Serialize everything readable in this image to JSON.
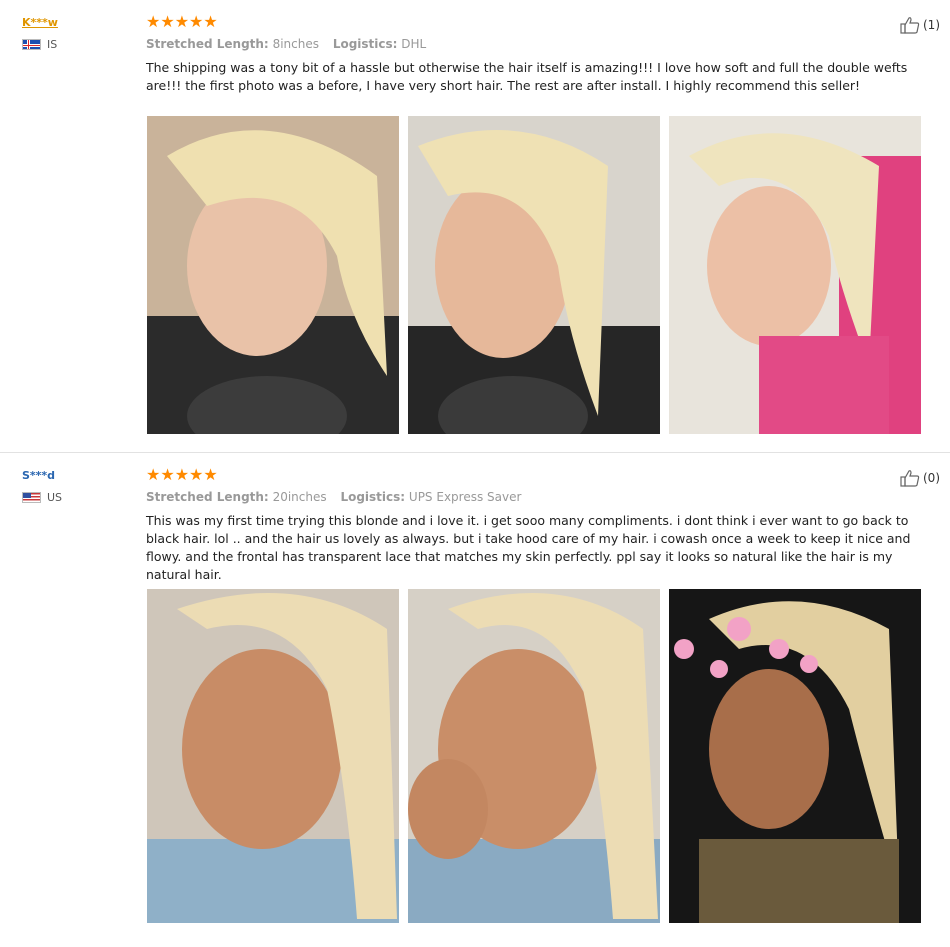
{
  "reviews": [
    {
      "user": "K***w",
      "country_code": "IS",
      "rating": "★★★★★",
      "length_label": "Stretched Length:",
      "length_value": "8inches",
      "logistics_label": "Logistics:",
      "logistics_value": "DHL",
      "helpful_count": "(1)",
      "text": "The shipping was a tony bit of a hassle but otherwise the hair itself is amazing!!! I love how soft and full the double wefts are!!! the first photo was a before, I have very short hair. The rest are after install. I highly recommend this seller!"
    },
    {
      "user": "S***d",
      "country_code": "US",
      "rating": "★★★★★",
      "length_label": "Stretched Length:",
      "length_value": "20inches",
      "logistics_label": "Logistics:",
      "logistics_value": "UPS Express Saver",
      "helpful_count": "(0)",
      "text": "This was my first time trying this blonde and i love it. i get sooo many compliments. i dont think i ever want to go back to black hair. lol .. and the hair us lovely as always. but i take hood care of my hair. i cowash once a week to keep it nice and flowy. and the frontal has transparent lace that matches my skin perfectly. ppl say it looks so natural like the hair is my natural hair."
    }
  ],
  "icons": {
    "star": "star-icon",
    "thumb": "thumbs-up-icon",
    "flag_is": "flag-is-icon",
    "flag_us": "flag-us-icon"
  },
  "colors": {
    "star": "#ff8a00",
    "user1": "#e09600",
    "user2": "#2a66b0"
  }
}
